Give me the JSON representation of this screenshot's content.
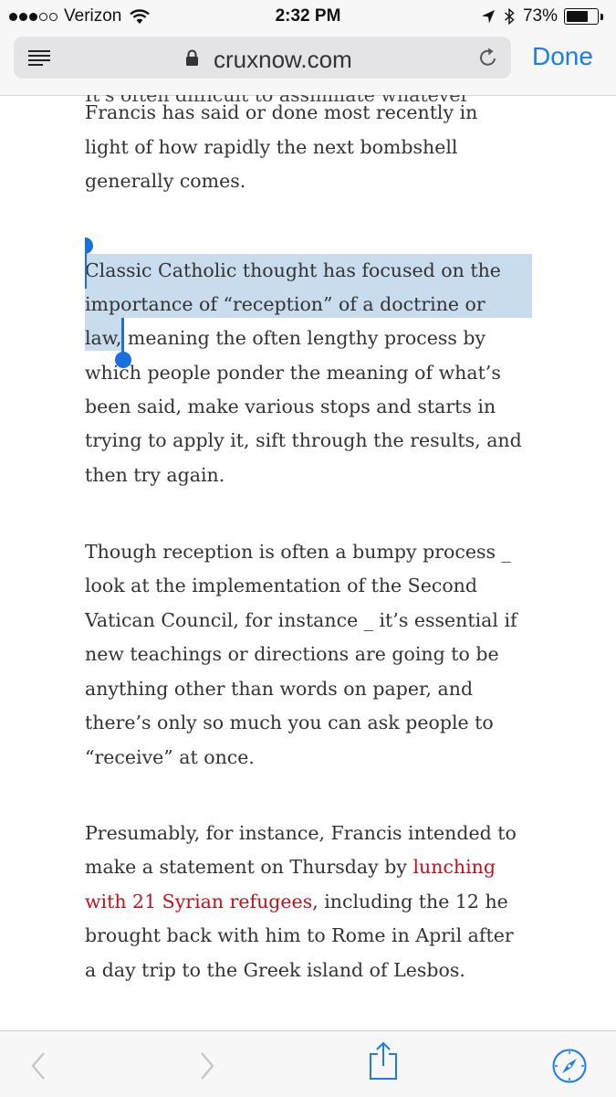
{
  "status_bar": {
    "carrier": "Verizon",
    "time": "2:32 PM",
    "battery_percent": "73%",
    "battery_level": 0.73,
    "signal_bars_filled": 3,
    "signal_bars_total": 5,
    "icons": [
      "wifi-icon",
      "location-arrow-icon",
      "bluetooth-icon",
      "battery-icon"
    ]
  },
  "address_bar": {
    "url": "cruxnow.com",
    "done_label": "Done",
    "icons": [
      "reader-menu-icon",
      "lock-icon",
      "reload-icon"
    ]
  },
  "article": {
    "partial_top_line": "It's often difficult to assimilate whatever",
    "paragraphs": [
      {
        "lines": [
          "Francis has said or done most recently in",
          "light of how rapidly the next bombshell",
          "generally comes."
        ]
      },
      {
        "lines": [
          "Classic Catholic thought has focused on the",
          "importance of “reception” of a doctrine or",
          "law, meaning the often lengthy process by",
          "which people ponder the meaning of what’s",
          "been said, make various stops and starts in",
          "trying to apply it, sift through the results, and",
          "then try again."
        ]
      },
      {
        "lines": [
          "Though reception is often a bumpy process _",
          "look at the implementation of the Second",
          "Vatican Council, for instance _ it’s essential if",
          "new teachings or directions are going to be",
          "anything other than words on paper, and",
          "there’s only so much you can ask people to",
          "“receive” at once."
        ]
      },
      {
        "lines": [
          "Presumably, for instance, Francis intended to",
          "make a statement on Thursday by ",
          "lunching",
          "with 21 Syrian refugees",
          ", including the 12 he",
          "brought back with him to Rome in April after",
          "a day trip to the Greek island of Lesbos."
        ]
      }
    ],
    "link_text": "lunching with 21 Syrian refugees",
    "link_color": "#c0121c",
    "selection_color": "#c9dcee",
    "handle_color": "#1a6fe0"
  },
  "toolbar": {
    "icons": [
      "back-icon",
      "forward-icon",
      "share-icon",
      "bookmarks-icon"
    ],
    "accent": "#1a7bf2"
  }
}
